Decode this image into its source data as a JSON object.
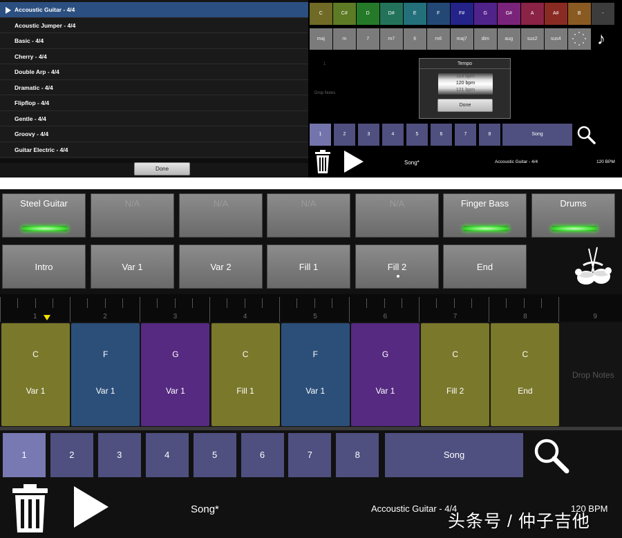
{
  "colors": {
    "selected_row": "#2b4f80",
    "bar_button": "#4f4f80",
    "bar_button_selected": "#7878b2",
    "led_green": "#48e33a",
    "playhead": "#f1e300",
    "chord_olive": "#7a782b",
    "chord_blue": "#2c4f7a",
    "chord_purple": "#552a80"
  },
  "style_list": {
    "items": [
      "Accoustic Guitar - 4/4",
      "Acoustic Jumper - 4/4",
      "Basic - 4/4",
      "Cherry - 4/4",
      "Double Arp - 4/4",
      "Dramatic - 4/4",
      "Flipflop - 4/4",
      "Gentle - 4/4",
      "Groovy - 4/4",
      "Guitar Electric - 4/4"
    ],
    "selected_index": 0,
    "done_label": "Done"
  },
  "chord_editor": {
    "notes": [
      {
        "label": "C",
        "color": "#6f6a25"
      },
      {
        "label": "C#",
        "color": "#5d7a25"
      },
      {
        "label": "D",
        "color": "#247a29"
      },
      {
        "label": "D#",
        "color": "#23735b"
      },
      {
        "label": "E",
        "color": "#23707a"
      },
      {
        "label": "F",
        "color": "#234876"
      },
      {
        "label": "F#",
        "color": "#24238a"
      },
      {
        "label": "G",
        "color": "#50238a"
      },
      {
        "label": "G#",
        "color": "#7a237a"
      },
      {
        "label": "A",
        "color": "#8a2345"
      },
      {
        "label": "A#",
        "color": "#8a2b23"
      },
      {
        "label": "B",
        "color": "#8a5a23"
      },
      {
        "label": "-",
        "color": "#3c3c3c"
      }
    ],
    "qualities": [
      "maj",
      "m",
      "7",
      "m7",
      "6",
      "m6",
      "maj7",
      "dim",
      "aug",
      "sus2",
      "sus4"
    ],
    "drop_notes_label": "Drop Notes",
    "ruler_label": "1",
    "tempo_dialog": {
      "title": "Tempo",
      "values": [
        "119 bpm",
        "120 bpm",
        "121 bpm"
      ],
      "done_label": "Done"
    },
    "bars": [
      "1",
      "2",
      "3",
      "4",
      "5",
      "6",
      "7",
      "8"
    ],
    "song_label": "Song",
    "footer_song": "Song*",
    "footer_style": "Accoustic Guitar - 4/4",
    "footer_bpm": "120 BPM"
  },
  "main": {
    "instruments": [
      {
        "label": "Steel Guitar",
        "available": true,
        "led": true
      },
      {
        "label": "N/A",
        "available": false,
        "led": false
      },
      {
        "label": "N/A",
        "available": false,
        "led": false
      },
      {
        "label": "N/A",
        "available": false,
        "led": false
      },
      {
        "label": "N/A",
        "available": false,
        "led": false
      },
      {
        "label": "Finger Bass",
        "available": true,
        "led": true
      },
      {
        "label": "Drums",
        "available": true,
        "led": true
      }
    ],
    "sections": [
      "Intro",
      "Var 1",
      "Var 2",
      "Fill 1",
      "Fill 2",
      "End"
    ],
    "ruler_bars": [
      "1",
      "2",
      "3",
      "4",
      "5",
      "6",
      "7",
      "8",
      "9"
    ],
    "chords": [
      {
        "chord": "C",
        "section": "Var 1",
        "color": "#7a782b"
      },
      {
        "chord": "F",
        "section": "Var 1",
        "color": "#2c4f7a"
      },
      {
        "chord": "G",
        "section": "Var 1",
        "color": "#552a80"
      },
      {
        "chord": "C",
        "section": "Fill 1",
        "color": "#7a782b"
      },
      {
        "chord": "F",
        "section": "Var 1",
        "color": "#2c4f7a"
      },
      {
        "chord": "G",
        "section": "Var 1",
        "color": "#552a80"
      },
      {
        "chord": "C",
        "section": "Fill 2",
        "color": "#7a782b"
      },
      {
        "chord": "C",
        "section": "End",
        "color": "#7a782b"
      }
    ],
    "drop_notes_label": "Drop Notes",
    "bars": [
      "1",
      "2",
      "3",
      "4",
      "5",
      "6",
      "7",
      "8"
    ],
    "selected_bar": 0,
    "song_label": "Song",
    "footer_song": "Song*",
    "footer_style": "Accoustic Guitar - 4/4",
    "footer_bpm": "120 BPM"
  },
  "watermark": "头条号 / 仲子吉他"
}
